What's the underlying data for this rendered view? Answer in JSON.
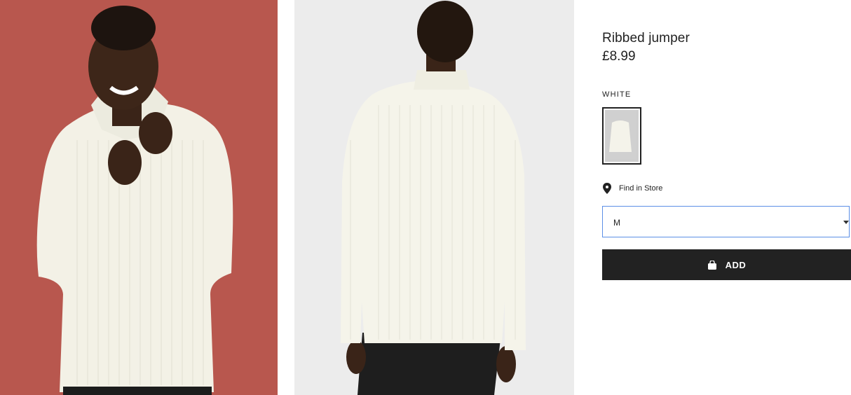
{
  "product": {
    "title": "Ribbed jumper",
    "price": "£8.99"
  },
  "color": {
    "name": "WHITE",
    "swatch_color": "#d0d0d0"
  },
  "store": {
    "label": "Find in Store",
    "icon": "location-pin-icon"
  },
  "size": {
    "selected": "M"
  },
  "add_button": {
    "label": "ADD",
    "icon": "shopping-bag-icon"
  },
  "colors": {
    "front_background": "#b8574e",
    "back_background": "#ececec",
    "button": "#222222",
    "select_border": "#5b8fe6"
  }
}
